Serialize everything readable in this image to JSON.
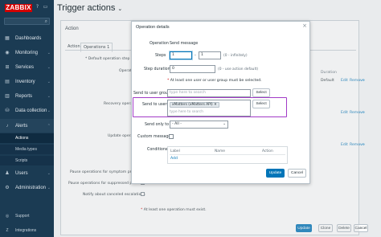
{
  "sidebar": {
    "logo": "ZABBIX",
    "items": [
      {
        "label": "Dashboards",
        "icon": "dashboard-icon"
      },
      {
        "label": "Monitoring",
        "icon": "eye-icon"
      },
      {
        "label": "Services",
        "icon": "services-icon"
      },
      {
        "label": "Inventory",
        "icon": "inventory-icon"
      },
      {
        "label": "Reports",
        "icon": "reports-icon"
      },
      {
        "label": "Data collection",
        "icon": "data-collection-icon"
      },
      {
        "label": "Alerts",
        "icon": "bell-icon"
      }
    ],
    "alerts_sub": [
      "Actions",
      "Media types",
      "Scripts"
    ],
    "items_after": [
      {
        "label": "Users",
        "icon": "users-icon"
      },
      {
        "label": "Administration",
        "icon": "gear-icon"
      }
    ],
    "bottom": [
      {
        "label": "Support",
        "icon": "support-icon"
      },
      {
        "label": "Integrations",
        "icon": "integrations-icon"
      }
    ]
  },
  "page": {
    "title": "Trigger actions",
    "title_chevron": "⌄"
  },
  "action_form": {
    "title": "Action",
    "tabs": [
      "Action",
      "Operations"
    ],
    "operations_count": "1",
    "default_step_label": "* Default operation step dur",
    "operations_label": "Operati",
    "recovery_label": "Recovery operati",
    "update_label": "Update operati",
    "col_duration": "Duration",
    "row_duration": "Default",
    "edit_link": "Edit",
    "remove_link": "Remove",
    "pause_symptom": "Pause operations for symptom probl",
    "pause_suppressed": "Pause operations for suppressed problems",
    "notify_canceled": "Notify about canceled escalations",
    "at_least_one_op": "At least one operation must exist.",
    "btn_update": "Update",
    "btn_clone": "Clone",
    "btn_delete": "Delete",
    "btn_cancel": "Cancel"
  },
  "modal": {
    "title": "Operation details",
    "operation_label": "Operation",
    "operation_value": "Send message",
    "steps_label": "Steps",
    "steps_from": "1",
    "steps_dash": "-",
    "steps_to": "1",
    "steps_hint": "(0 - infinitely)",
    "step_duration_label": "Step duration",
    "step_duration_value": "0",
    "step_duration_hint": "(0 - use action default)",
    "user_group_warning": "At least one user or user group must be selected.",
    "send_to_groups_label": "Send to user groups",
    "groups_placeholder": "type here to search",
    "send_to_users_label": "Send to users",
    "user_tag": "xMatters (xMatters API)",
    "users_placeholder": "type here to search",
    "select_label": "Select",
    "send_only_to_label": "Send only to",
    "send_only_to_value": "- All -",
    "custom_message_label": "Custom message",
    "conditions_label": "Conditions",
    "cond_col_label": "Label",
    "cond_col_name": "Name",
    "cond_col_action": "Action",
    "add_link": "Add",
    "btn_update": "Update",
    "btn_cancel": "Cancel",
    "close_glyph": "×"
  }
}
